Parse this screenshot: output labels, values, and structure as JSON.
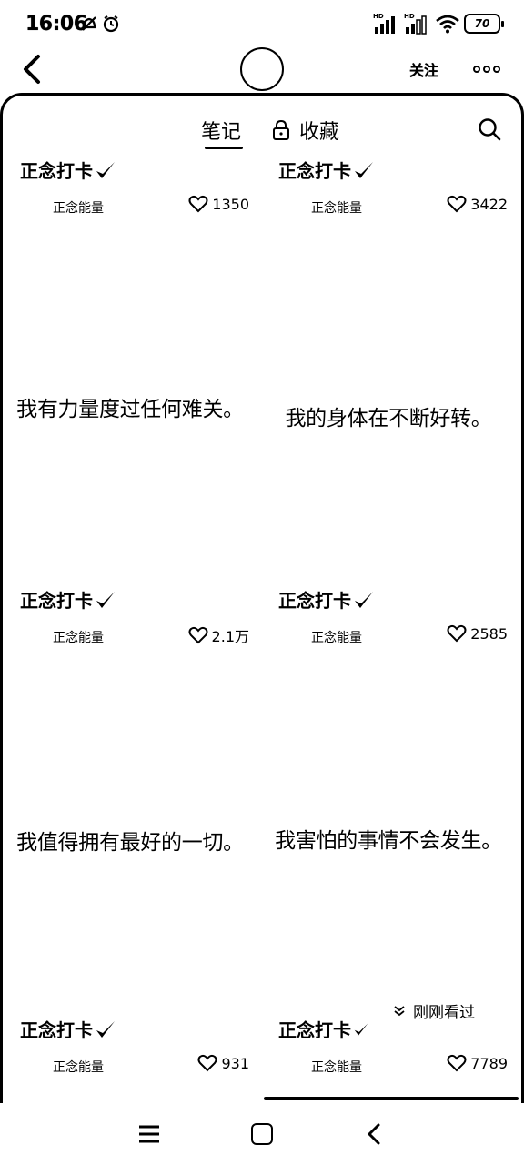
{
  "status_bar": {
    "time": "16:06",
    "battery": "70"
  },
  "top_nav": {
    "follow_label": "关注"
  },
  "tabs": {
    "notes_label": "笔记",
    "favorites_label": "收藏"
  },
  "cards": [
    {
      "title": "正念打卡",
      "author": "正念能量",
      "likes": "1350",
      "text": "我有力量度过任何难关。"
    },
    {
      "title": "正念打卡",
      "author": "正念能量",
      "likes": "3422",
      "text": "我的身体在不断好转。"
    },
    {
      "title": "正念打卡",
      "author": "正念能量",
      "likes": "2.1万",
      "text": "我值得拥有最好的一切。"
    },
    {
      "title": "正念打卡",
      "author": "正念能量",
      "likes": "2585",
      "text": "我害怕的事情不会发生。"
    },
    {
      "title": "正念打卡",
      "author": "正念能量",
      "likes": "931",
      "text": ""
    },
    {
      "title": "正念打卡",
      "author": "正念能量",
      "likes": "7789",
      "text": ""
    }
  ],
  "just_seen_label": "刚刚看过",
  "icons": {
    "back": "chevron-left-icon",
    "more": "more-dots-icon",
    "lock": "lock-icon",
    "search": "search-icon",
    "heart": "heart-icon",
    "check": "check-icon"
  }
}
